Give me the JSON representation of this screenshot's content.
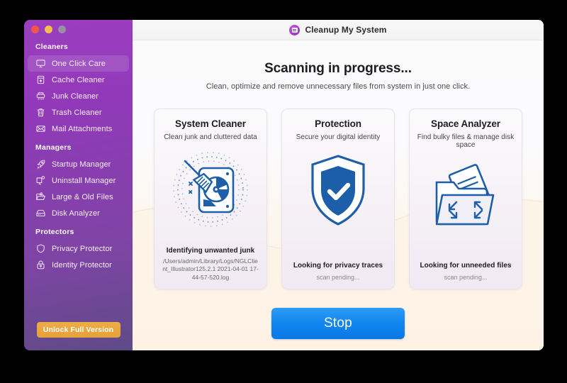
{
  "window": {
    "traffic_lights": [
      "close",
      "minimize",
      "zoom"
    ],
    "app_title": "Cleanup My System",
    "app_logo_icon": "app-logo-icon"
  },
  "sidebar": {
    "sections": [
      {
        "header": "Cleaners",
        "items": [
          {
            "label": "One Click Care",
            "icon": "monitor-icon",
            "active": true
          },
          {
            "label": "Cache Cleaner",
            "icon": "cache-box-icon",
            "active": false
          },
          {
            "label": "Junk Cleaner",
            "icon": "shredder-icon",
            "active": false
          },
          {
            "label": "Trash Cleaner",
            "icon": "trash-icon",
            "active": false
          },
          {
            "label": "Mail Attachments",
            "icon": "envelope-icon",
            "active": false
          }
        ]
      },
      {
        "header": "Managers",
        "items": [
          {
            "label": "Startup Manager",
            "icon": "rocket-icon",
            "active": false
          },
          {
            "label": "Uninstall Manager",
            "icon": "monitor-gear-icon",
            "active": false
          },
          {
            "label": "Large & Old Files",
            "icon": "folder-files-icon",
            "active": false
          },
          {
            "label": "Disk Analyzer",
            "icon": "disk-icon",
            "active": false
          }
        ]
      },
      {
        "header": "Protectors",
        "items": [
          {
            "label": "Privacy Protector",
            "icon": "shield-icon",
            "active": false
          },
          {
            "label": "Identity Protector",
            "icon": "lock-icon",
            "active": false
          }
        ]
      }
    ],
    "unlock_button": "Unlock Full Version"
  },
  "main": {
    "title": "Scanning in progress...",
    "subtitle": "Clean, optimize and remove unnecessary files from system in just one click.",
    "cards": [
      {
        "title": "System Cleaner",
        "subtitle": "Clean junk and cluttered data",
        "art_icon": "broom-disk-scan-icon",
        "status": "Identifying unwanted junk",
        "detail": "/Users/admin/Library/Logs/NGLClient_Illustrator125.2.1 2021-04-01 17-44-57-520.log",
        "pending": false
      },
      {
        "title": "Protection",
        "subtitle": "Secure your digital identity",
        "art_icon": "shield-check-icon",
        "status": "Looking for privacy traces",
        "detail": "scan pending...",
        "pending": true
      },
      {
        "title": "Space Analyzer",
        "subtitle": "Find bulky files & manage disk space",
        "art_icon": "folder-expand-icon",
        "status": "Looking for unneeded files",
        "detail": "scan pending...",
        "pending": true
      }
    ],
    "stop_button": "Stop"
  },
  "colors": {
    "sidebar_top": "#9a3fbe",
    "sidebar_bottom": "#5f4b86",
    "accent_blue": "#1186f0",
    "unlock_orange": "#e5a13a",
    "icon_blue": "#1f5fa8",
    "traffic_red": "#f2564a",
    "traffic_yellow": "#f5bf4f",
    "traffic_gray": "#9b8fa4"
  }
}
